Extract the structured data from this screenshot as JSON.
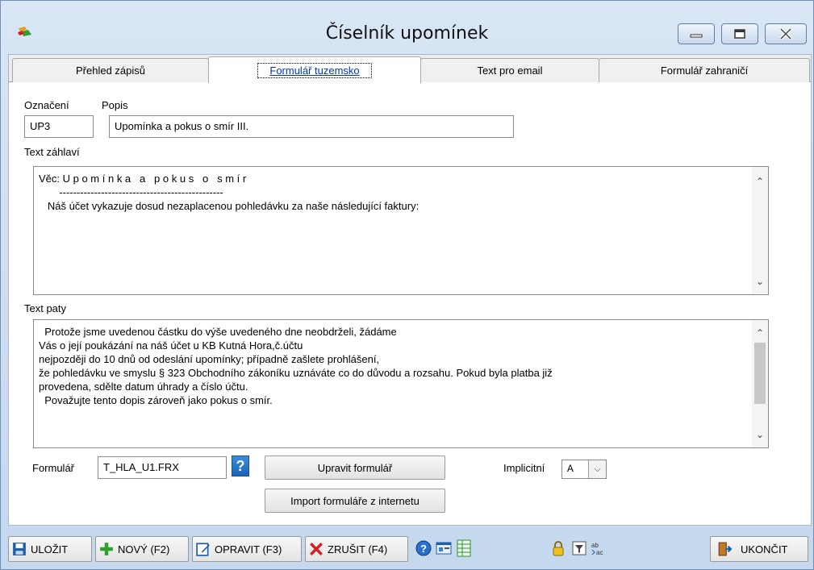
{
  "window": {
    "title": "Číselník upomínek"
  },
  "tabs": [
    {
      "label": "Přehled zápisů"
    },
    {
      "label": "Formulář tuzemsko"
    },
    {
      "label": "Text pro email"
    },
    {
      "label": "Formulář zahraničí"
    }
  ],
  "form": {
    "oznaceni_label": "Označení",
    "popis_label": "Popis",
    "oznaceni_value": "UP3",
    "popis_value": "Upomínka a pokus o smír III.",
    "header_label": "Text záhlaví",
    "header_text": "Věc: U p o m í n k a   a   p o k u s   o   s m í r\n       -----------------------------------------------\n   Náš účet vykazuje dosud nezaplacenou pohledávku za naše následující faktury:",
    "footer_label": "Text paty",
    "footer_text": "  Protože jsme uvedenou částku do výše uvedeného dne neobdrželi, žádáme\nVás o její poukázání na náš účet u KB Kutná Hora,č.účtu\nnejpozději do 10 dnů od odeslání upomínky; případně zašlete prohlášení,\nže pohledávku ve smyslu § 323 Obchodního zákoníku uznáváte co do důvodu a rozsahu. Pokud byla platba již\nprovedena, sdělte datum úhrady a číslo účtu.\n  Považujte tento dopis zároveň jako pokus o smír.",
    "formular_label": "Formulář",
    "formular_value": "T_HLA_U1.FRX",
    "help_label": "?",
    "edit_form_button": "Upravit formulář",
    "import_form_button": "Import formuláře z internetu",
    "implicitni_label": "Implicitní",
    "implicitni_value": "A"
  },
  "toolbar": {
    "save": "ULOŽIT",
    "new": "NOVÝ (F2)",
    "edit": "OPRAVIT (F3)",
    "cancel": "ZRUŠIT (F4)",
    "exit": "UKONČIT"
  },
  "colors": {
    "link_tab": "#0033cc",
    "help_blue": "#1b62b8",
    "save_blue": "#1f5fa8",
    "new_green": "#2fa02f",
    "cancel_red": "#d42020"
  }
}
